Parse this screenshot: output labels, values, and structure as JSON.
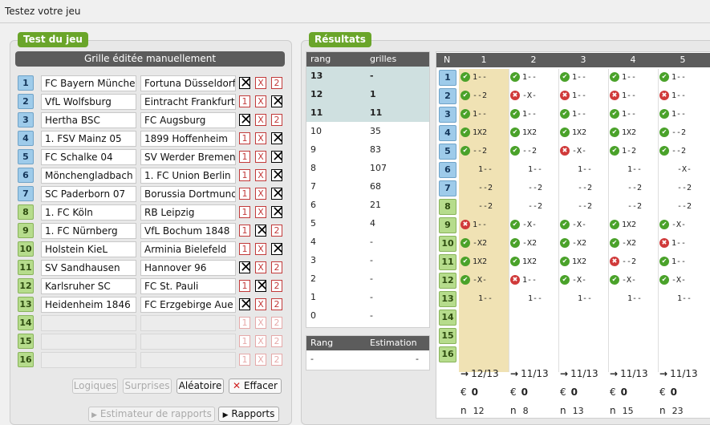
{
  "window": {
    "title": "Testez votre jeu"
  },
  "test": {
    "badge": "Test du jeu",
    "grille_header": "Grille éditée manuellement",
    "rows": [
      {
        "n": "1",
        "home": "FC Bayern München",
        "away": "Fortuna Düsseldorf",
        "sel": "1"
      },
      {
        "n": "2",
        "home": "VfL Wolfsburg",
        "away": "Eintracht Frankfurt",
        "sel": "2"
      },
      {
        "n": "3",
        "home": "Hertha BSC",
        "away": "FC Augsburg",
        "sel": "1"
      },
      {
        "n": "4",
        "home": "1. FSV Mainz 05",
        "away": "1899 Hoffenheim",
        "sel": "2"
      },
      {
        "n": "5",
        "home": "FC Schalke 04",
        "away": "SV Werder Bremen",
        "sel": "2"
      },
      {
        "n": "6",
        "home": "Mönchengladbach",
        "away": "1. FC Union Berlin",
        "sel": "2"
      },
      {
        "n": "7",
        "home": "SC Paderborn 07",
        "away": "Borussia Dortmund",
        "sel": "2"
      },
      {
        "n": "8",
        "home": "1. FC Köln",
        "away": "RB Leipzig",
        "sel": "2"
      },
      {
        "n": "9",
        "home": "1. FC Nürnberg",
        "away": "VfL Bochum 1848",
        "sel": "X"
      },
      {
        "n": "10",
        "home": "Holstein KieL",
        "away": "Arminia Bielefeld",
        "sel": "2"
      },
      {
        "n": "11",
        "home": "SV Sandhausen",
        "away": "Hannover 96",
        "sel": "1"
      },
      {
        "n": "12",
        "home": "Karlsruher SC",
        "away": "FC St. Pauli",
        "sel": "X"
      },
      {
        "n": "13",
        "home": "Heidenheim 1846",
        "away": "FC Erzgebirge Aue",
        "sel": "1"
      },
      {
        "n": "14",
        "home": "",
        "away": "",
        "sel": ""
      },
      {
        "n": "15",
        "home": "",
        "away": "",
        "sel": ""
      },
      {
        "n": "16",
        "home": "",
        "away": "",
        "sel": ""
      }
    ],
    "opts": [
      "1",
      "X",
      "2"
    ],
    "buttons": {
      "logiques": "Logiques",
      "surprises": "Surprises",
      "aleatoire": "Aléatoire",
      "effacer": "Effacer",
      "estimateur": "Estimateur de rapports",
      "rapports": "Rapports"
    }
  },
  "results": {
    "badge": "Résultats",
    "rang_header": "rang",
    "grilles_header": "grilles",
    "rangs": [
      {
        "rang": "13",
        "grilles": "-"
      },
      {
        "rang": "12",
        "grilles": "1"
      },
      {
        "rang": "11",
        "grilles": "11"
      },
      {
        "rang": "10",
        "grilles": "35"
      },
      {
        "rang": "9",
        "grilles": "83"
      },
      {
        "rang": "8",
        "grilles": "107"
      },
      {
        "rang": "7",
        "grilles": "68"
      },
      {
        "rang": "6",
        "grilles": "21"
      },
      {
        "rang": "5",
        "grilles": "4"
      },
      {
        "rang": "4",
        "grilles": "-"
      },
      {
        "rang": "3",
        "grilles": "-"
      },
      {
        "rang": "2",
        "grilles": "-"
      },
      {
        "rang": "1",
        "grilles": "-"
      },
      {
        "rang": "0",
        "grilles": "-"
      }
    ],
    "est_header": {
      "rang": "Rang",
      "estimation": "Estimation"
    },
    "est_row": {
      "rang": "-",
      "estimation": "-"
    },
    "grid_n_header": "N",
    "grid_cols": [
      "1",
      "2",
      "3",
      "4",
      "5"
    ],
    "grid": [
      [
        "ok:1--",
        "ok:1--",
        "ok:1--",
        "ok:1--",
        "ok:1--"
      ],
      [
        "ok:--2",
        "bad:-X-",
        "bad:1--",
        "bad:1--",
        "bad:1--"
      ],
      [
        "ok:1--",
        "ok:1--",
        "ok:1--",
        "ok:1--",
        "ok:1--"
      ],
      [
        "ok:1X2",
        "ok:1X2",
        "ok:1X2",
        "ok:1X2",
        "ok:--2"
      ],
      [
        "ok:--2",
        "ok:--2",
        "bad:-X-",
        "ok:1-2",
        "ok:--2"
      ],
      [
        ":1--",
        ":1--",
        ":1--",
        ":1--",
        ":-X-"
      ],
      [
        ":--2",
        ":--2",
        ":--2",
        ":--2",
        ":--2"
      ],
      [
        ":--2",
        ":--2",
        ":--2",
        ":--2",
        ":--2"
      ],
      [
        "bad:1--",
        "ok:-X-",
        "ok:-X-",
        "ok:1X2",
        "ok:-X-"
      ],
      [
        "ok:-X2",
        "ok:-X2",
        "ok:-X2",
        "ok:-X2",
        "bad:1--"
      ],
      [
        "ok:1X2",
        "ok:1X2",
        "ok:1X2",
        "bad:--2",
        "ok:1--"
      ],
      [
        "ok:-X-",
        "bad:1--",
        "ok:-X-",
        "ok:-X-",
        "ok:-X-"
      ],
      [
        ":1--",
        ":1--",
        ":1--",
        ":1--",
        ":1--"
      ],
      [
        "",
        "",
        "",
        "",
        ""
      ],
      [
        "",
        "",
        "",
        "",
        ""
      ],
      [
        "",
        "",
        "",
        "",
        ""
      ]
    ],
    "row_numbers": [
      "1",
      "2",
      "3",
      "4",
      "5",
      "6",
      "7",
      "8",
      "9",
      "10",
      "11",
      "12",
      "13",
      "14",
      "15",
      "16"
    ],
    "footer": [
      {
        "score": "12/13",
        "gain": "0",
        "n": "12"
      },
      {
        "score": "11/13",
        "gain": "0",
        "n": "8"
      },
      {
        "score": "11/13",
        "gain": "0",
        "n": "13"
      },
      {
        "score": "11/13",
        "gain": "0",
        "n": "15"
      },
      {
        "score": "11/13",
        "gain": "0",
        "n": "23"
      }
    ],
    "footer_icons": {
      "score": "→",
      "gain": "€",
      "n": "n"
    }
  },
  "colors": {
    "accent": "#6aa52a",
    "header_dark": "#5c5c5c",
    "highlight_col": "#f0e2b4",
    "top_rank_bg": "#cfe0e0"
  }
}
